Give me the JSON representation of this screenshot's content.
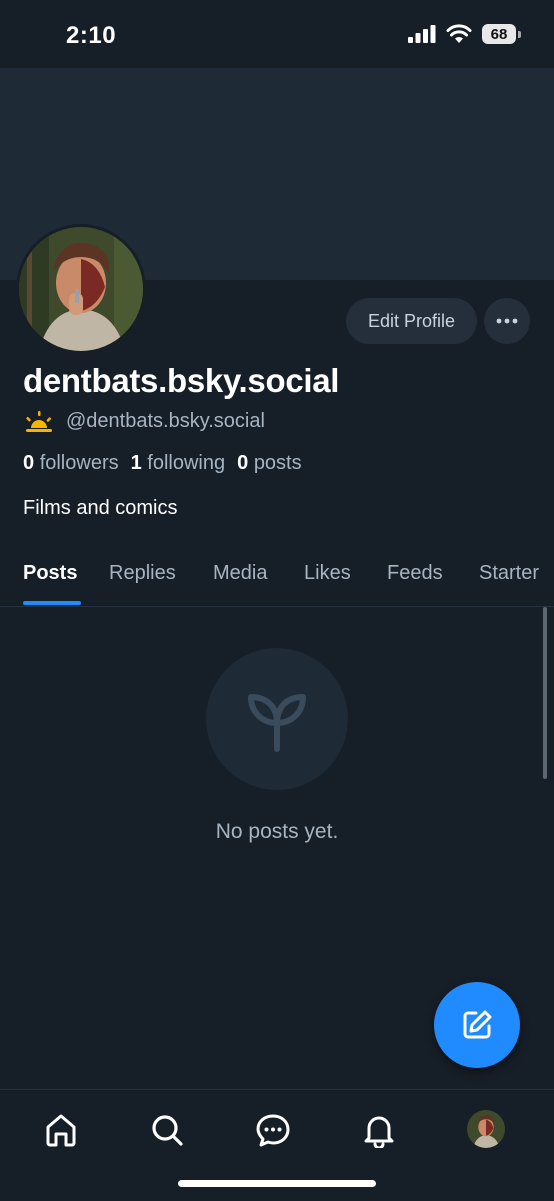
{
  "status_bar": {
    "time": "2:10",
    "battery": "68"
  },
  "profile": {
    "display_name": "dentbats.bsky.social",
    "handle": "@dentbats.bsky.social",
    "handle_emoji_icon": "sunrise-icon",
    "bio": "Films and comics",
    "stats": {
      "followers_count": "0",
      "followers_label": "followers",
      "following_count": "1",
      "following_label": "following",
      "posts_count": "0",
      "posts_label": "posts"
    },
    "edit_profile_label": "Edit Profile"
  },
  "tabs": [
    {
      "label": "Posts",
      "active": true
    },
    {
      "label": "Replies"
    },
    {
      "label": "Media"
    },
    {
      "label": "Likes"
    },
    {
      "label": "Feeds"
    },
    {
      "label": "Starter"
    }
  ],
  "empty_state": {
    "icon": "sprout-icon",
    "text": "No posts yet."
  },
  "fab": {
    "icon": "compose-icon"
  },
  "bottom_nav": [
    "home-icon",
    "search-icon",
    "chat-icon",
    "bell-icon",
    "profile-avatar"
  ],
  "colors": {
    "background": "#161e27",
    "banner": "#1e2a36",
    "accent": "#208bfe",
    "muted_text": "#a7b4c1"
  }
}
